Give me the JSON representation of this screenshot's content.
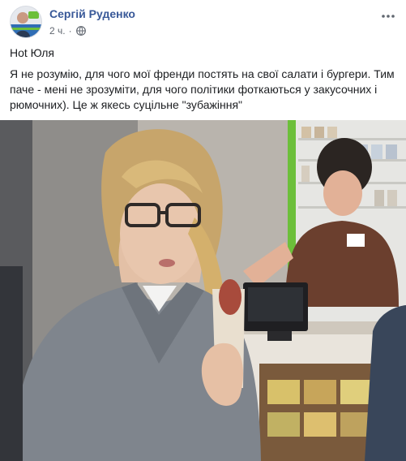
{
  "post": {
    "author": "Сергій Руденко",
    "time": "2 ч.",
    "separator": "·",
    "audience_icon": "globe-icon",
    "more_icon": "more-horizontal-icon",
    "title": "Hot Юля",
    "body": "Я не розумію, для чого мої френди постять на свої салати і бургери. Тим паче - мені не зрозуміти, для чого політики фоткаються у закусочних і рюмочних). Це ж якесь суцільне \"зубажіння\"",
    "photo_alt": "Photo"
  },
  "colors": {
    "author": "#385898",
    "meta": "#616770",
    "text": "#1c1e21",
    "accent_green": "#6cbf3a"
  }
}
